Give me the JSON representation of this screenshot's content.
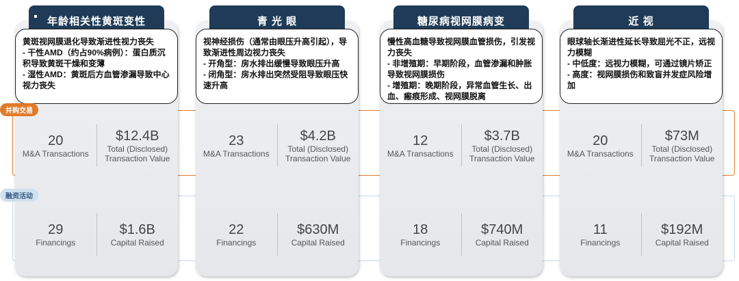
{
  "tags": {
    "ma": "并购交易",
    "financing": "融资活动"
  },
  "columns": [
    {
      "title": "年龄相关性黄斑变性",
      "desc": [
        "黄斑视网膜退化导致渐进性视力丧失",
        "- 干性AMD（约占90%病例）：蛋白质沉积导致黄斑干燥和变薄",
        "- 湿性AMD：黄斑后方血管渗漏导致中心视力丧失"
      ],
      "ma": {
        "count": "20",
        "count_label": "M&A Transactions",
        "value": "$12.4B",
        "value_label": "Total (Disclosed) Transaction Value"
      },
      "fin": {
        "count": "29",
        "count_label": "Financings",
        "value": "$1.6B",
        "value_label": "Capital Raised"
      }
    },
    {
      "title": "青 光 眼",
      "desc": [
        "视神经损伤（通常由眼压升高引起），导致渐进性周边视力丧失",
        "- 开角型：房水排出缓慢导致眼压升高",
        "- 闭角型：房水排出突然受阻导致眼压快速升高"
      ],
      "ma": {
        "count": "23",
        "count_label": "M&A Transactions",
        "value": "$4.2B",
        "value_label": "Total (Disclosed) Transaction Value"
      },
      "fin": {
        "count": "22",
        "count_label": "Financings",
        "value": "$630M",
        "value_label": "Capital Raised"
      }
    },
    {
      "title": "糖尿病视网膜病变",
      "desc": [
        "慢性高血糖导致视网膜血管损伤，引发视力丧失",
        "- 非增殖期：早期阶段，血管渗漏和肿胀导致视网膜损伤",
        "- 增殖期：晚期阶段，异常血管生长、出血、瘢痕形成、视网膜脱离"
      ],
      "ma": {
        "count": "12",
        "count_label": "M&A Transactions",
        "value": "$3.7B",
        "value_label": "Total (Disclosed) Transaction Value"
      },
      "fin": {
        "count": "18",
        "count_label": "Financings",
        "value": "$740M",
        "value_label": "Capital Raised"
      }
    },
    {
      "title": "近 视",
      "desc": [
        "眼球轴长渐进性延长导致屈光不正，远视力模糊",
        "- 中低度：远视力模糊，可通过镜片矫正",
        "- 高度：视网膜损伤和致盲并发症风险增加"
      ],
      "ma": {
        "count": "20",
        "count_label": "M&A Transactions",
        "value": "$73M",
        "value_label": "Total (Disclosed) Transaction Value"
      },
      "fin": {
        "count": "11",
        "count_label": "Financings",
        "value": "$192M",
        "value_label": "Capital Raised"
      }
    }
  ]
}
